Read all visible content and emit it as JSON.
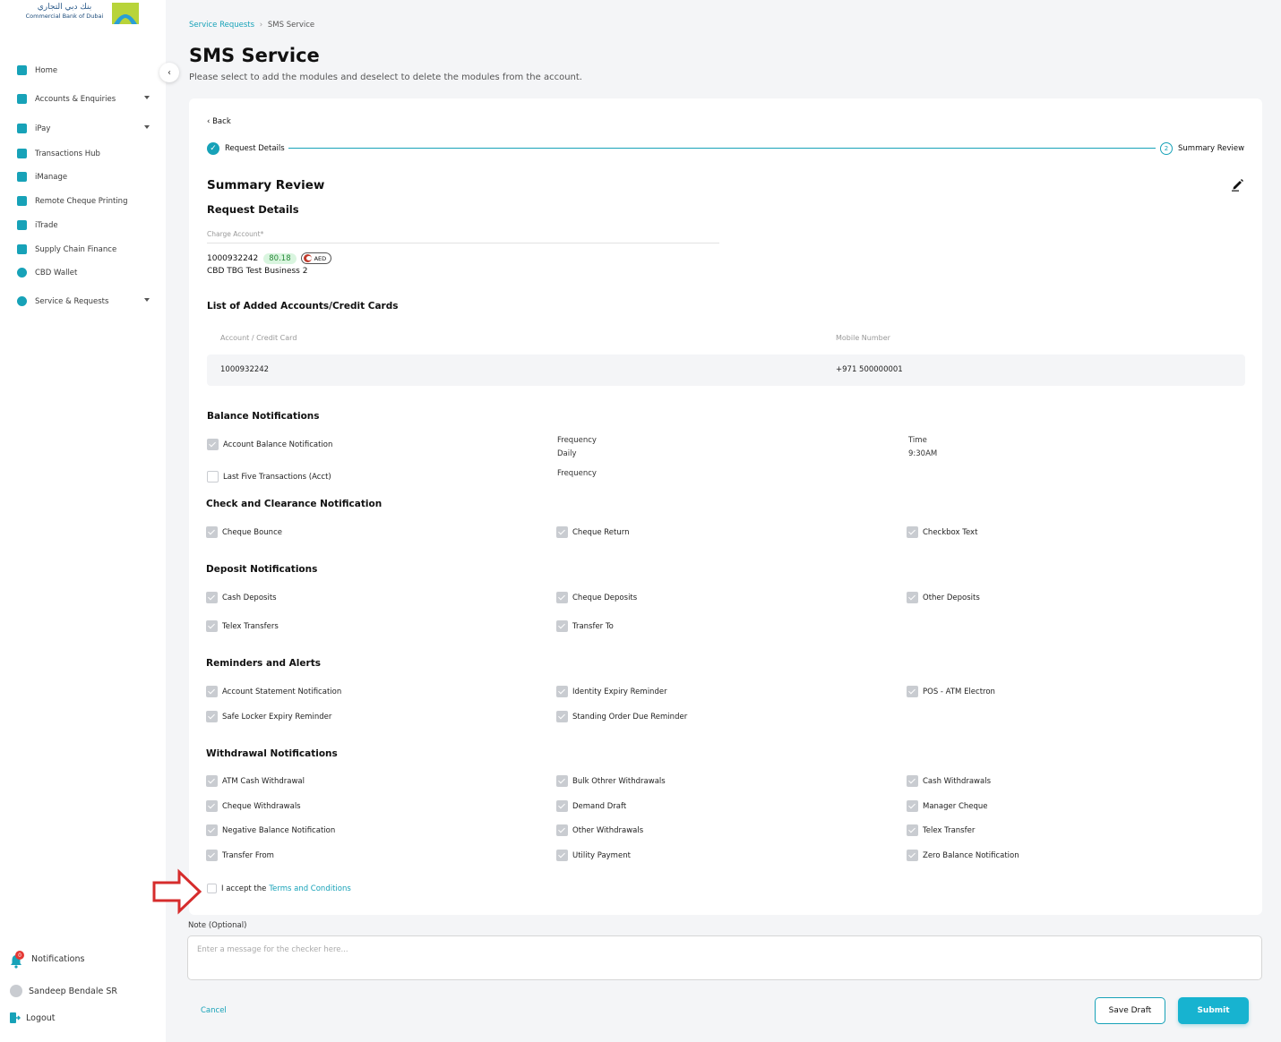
{
  "brand": {
    "arabic_name": "بنك دبي التجاري",
    "english_name": "Commercial Bank of Dubai"
  },
  "sidebar": {
    "items": [
      {
        "label": "Home",
        "icon": "home-grid-icon",
        "has_dropdown": false
      },
      {
        "label": "Accounts & Enquiries",
        "icon": "accounts-icon",
        "has_dropdown": true
      },
      {
        "label": "iPay",
        "icon": "ipay-stack-icon",
        "has_dropdown": true
      },
      {
        "label": "Transactions Hub",
        "icon": "transactions-hub-icon",
        "has_dropdown": false
      },
      {
        "label": "iManage",
        "icon": "imanage-icon",
        "has_dropdown": false
      },
      {
        "label": "Remote Cheque Printing",
        "icon": "cheque-printing-icon",
        "has_dropdown": false
      },
      {
        "label": "iTrade",
        "icon": "itrade-chart-icon",
        "has_dropdown": false
      },
      {
        "label": "Supply Chain Finance",
        "icon": "supply-chain-icon",
        "has_dropdown": false
      },
      {
        "label": "CBD Wallet",
        "icon": "wallet-icon",
        "has_dropdown": false
      },
      {
        "label": "Service & Requests",
        "icon": "service-requests-icon",
        "has_dropdown": true
      }
    ],
    "notifications_label": "Notifications",
    "notifications_count": "0",
    "user_name": "Sandeep Bendale SR",
    "logout_label": "Logout"
  },
  "breadcrumb": {
    "parent": "Service Requests",
    "separator": "›",
    "current": "SMS Service"
  },
  "page": {
    "title": "SMS Service",
    "subtitle": "Please select to add the modules and deselect to delete the modules from the account."
  },
  "card": {
    "back_label": "‹ Back",
    "steps": [
      {
        "number": "✓",
        "label": "Request Details",
        "state": "complete"
      },
      {
        "number": "2",
        "label": "Summary Review",
        "state": "current"
      }
    ],
    "summary_title": "Summary Review",
    "request_details_title": "Request Details",
    "charge_account": {
      "label": "Charge Account*",
      "number": "1000932242",
      "balance": "80.18",
      "currency": "AED",
      "name": "CBD TBG Test Business 2"
    },
    "list_title": "List of Added Accounts/Credit Cards",
    "table": {
      "headers": [
        "Account / Credit Card",
        "Mobile Number"
      ],
      "rows": [
        [
          "1000932242",
          "+971 500000001"
        ]
      ]
    },
    "balance_notifications": {
      "title": "Balance Notifications",
      "items": [
        {
          "label": "Account Balance Notification",
          "checked": true,
          "frequency_label": "Frequency",
          "frequency_value": "Daily",
          "time_label": "Time",
          "time_value": "9:30AM"
        },
        {
          "label": "Last Five Transactions (Acct)",
          "checked": false,
          "frequency_label": "Frequency"
        }
      ]
    },
    "check_clearance": {
      "title": "Check and Clearance Notification",
      "items": [
        "Cheque Bounce",
        "Cheque Return",
        "Checkbox Text"
      ]
    },
    "deposit_notifications": {
      "title": "Deposit Notifications",
      "items": [
        "Cash Deposits",
        "Cheque Deposits",
        "Other Deposits",
        "Telex Transfers",
        "Transfer To"
      ]
    },
    "reminders_alerts": {
      "title": "Reminders and Alerts",
      "items": [
        "Account Statement Notification",
        "Identity Expiry Reminder",
        "POS - ATM Electron",
        "Safe Locker Expiry Reminder",
        "Standing Order Due Reminder"
      ]
    },
    "withdrawal_notifications": {
      "title": "Withdrawal Notifications",
      "items": [
        "ATM Cash Withdrawal",
        "Bulk Othrer Withdrawals",
        "Cash Withdrawals",
        "Cheque Withdrawals",
        "Demand Draft",
        "Manager Cheque",
        "Negative Balance Notification",
        "Other Withdrawals",
        "Telex Transfer",
        "Transfer From",
        "Utility Payment",
        "Zero Balance Notification"
      ]
    },
    "terms": {
      "prefix": "I accept the",
      "link": "Terms and Conditions",
      "checked": false
    }
  },
  "note": {
    "label": "Note (Optional)",
    "placeholder": "Enter a message for the checker here..."
  },
  "actions": {
    "cancel": "Cancel",
    "save_draft": "Save Draft",
    "submit": "Submit"
  },
  "colors": {
    "accent": "#17a2b8",
    "arrow": "#d62c2c",
    "balance_chip": "#d9f5df"
  }
}
